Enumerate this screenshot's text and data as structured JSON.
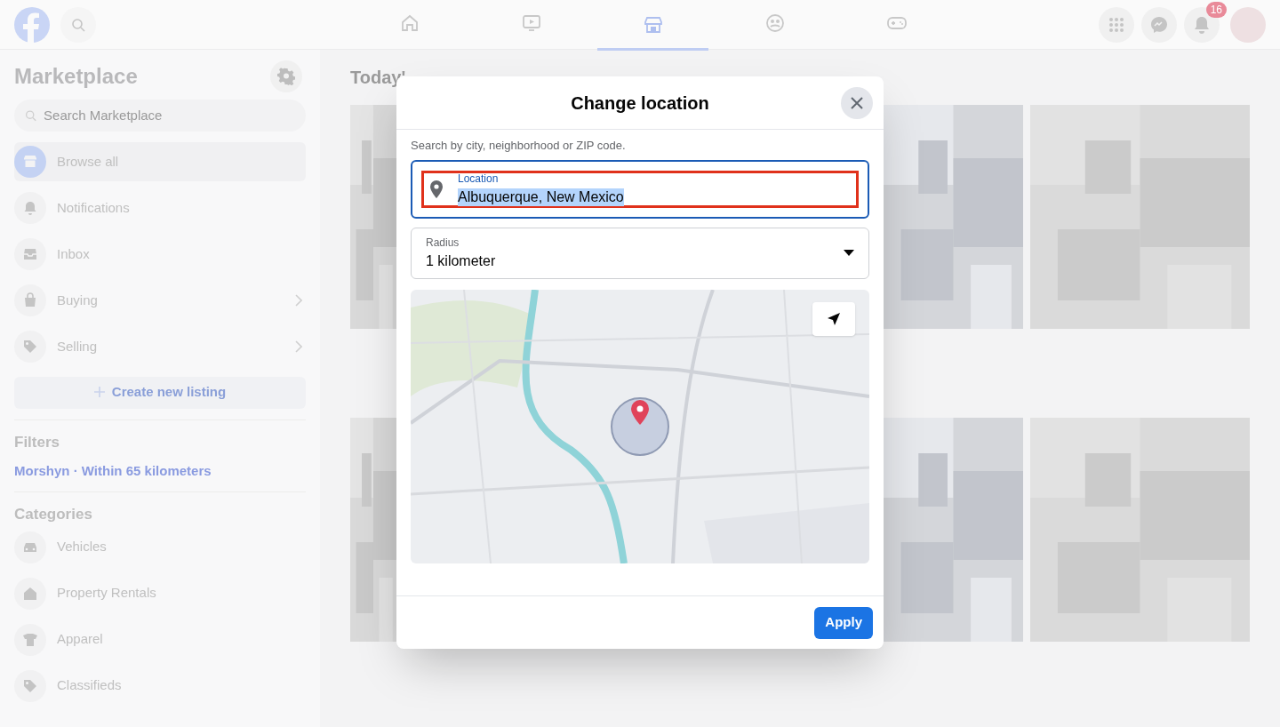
{
  "topbar": {
    "nav": [
      {
        "kind": "home",
        "selected": false
      },
      {
        "kind": "video",
        "selected": false
      },
      {
        "kind": "marketplace",
        "selected": true
      },
      {
        "kind": "groups",
        "selected": false
      },
      {
        "kind": "gaming",
        "selected": false
      }
    ],
    "notification_count": "16"
  },
  "sidebar": {
    "title": "Marketplace",
    "search": {
      "placeholder": "Search Marketplace"
    },
    "items": [
      {
        "kind": "store",
        "label": "Browse all",
        "selected": true,
        "chevron": false
      },
      {
        "kind": "bell",
        "label": "Notifications",
        "selected": false,
        "chevron": false
      },
      {
        "kind": "inbox",
        "label": "Inbox",
        "selected": false,
        "chevron": false
      },
      {
        "kind": "bag",
        "label": "Buying",
        "selected": false,
        "chevron": true
      },
      {
        "kind": "tag",
        "label": "Selling",
        "selected": false,
        "chevron": true
      }
    ],
    "create_button": "Create new listing",
    "filters_heading": "Filters",
    "filter_link": "Morshyn · Within 65 kilometers",
    "categories_heading": "Categories",
    "categories": [
      {
        "kind": "car",
        "label": "Vehicles"
      },
      {
        "kind": "house",
        "label": "Property Rentals"
      },
      {
        "kind": "shirt",
        "label": "Apparel"
      },
      {
        "kind": "tag",
        "label": "Classifieds"
      }
    ]
  },
  "main": {
    "heading": "Today'"
  },
  "dialog": {
    "title": "Change location",
    "hint": "Search by city, neighborhood or ZIP code.",
    "location_field": {
      "label": "Location",
      "value": "Albuquerque, New Mexico",
      "highlighted": true
    },
    "radius_field": {
      "label": "Radius",
      "value": "1 kilometer"
    },
    "apply_button": "Apply"
  }
}
